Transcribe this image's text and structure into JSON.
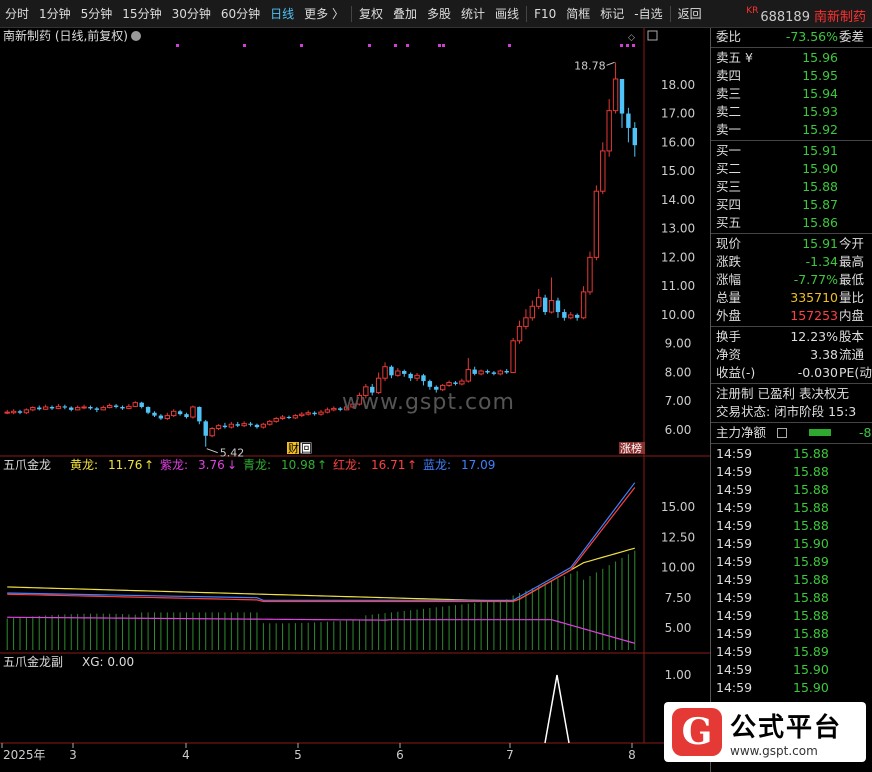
{
  "toolbar": {
    "items": [
      "分时",
      "1分钟",
      "5分钟",
      "15分钟",
      "30分钟",
      "60分钟",
      "日线",
      "更多 〉",
      "复权",
      "叠加",
      "多股",
      "统计",
      "画线",
      "F10",
      "简框",
      "标记",
      "-自选",
      "返回"
    ],
    "active": "日线"
  },
  "stock": {
    "badge": "KR",
    "code": "688189",
    "name": "南新制药"
  },
  "main_chart": {
    "title": "南新制药 (日线,前复权)",
    "title_icon": "chevron-down-icon",
    "y_ticks": [
      "18.00",
      "17.00",
      "16.00",
      "15.00",
      "14.00",
      "13.00",
      "12.00",
      "11.00",
      "10.00",
      "9.00",
      "8.00",
      "7.00",
      "6.00"
    ],
    "high_label": "18.78",
    "low_label": "5.42",
    "tag_cai": "财",
    "tag_hui": "回",
    "tag_zhangbang": "涨榜"
  },
  "indicator1": {
    "name": "五爪金龙",
    "labels": [
      {
        "name": "黄龙:",
        "value": "11.76",
        "arrow": "↑",
        "color": "#f0e040"
      },
      {
        "name": "紫龙:",
        "value": "3.76",
        "arrow": "↓",
        "color": "#e040e0"
      },
      {
        "name": "青龙:",
        "value": "10.98",
        "arrow": "↑",
        "color": "#30b030"
      },
      {
        "name": "红龙:",
        "value": "16.71",
        "arrow": "↑",
        "color": "#ff4040"
      },
      {
        "name": "蓝龙:",
        "value": "17.09",
        "arrow": "",
        "color": "#4080ff"
      }
    ],
    "y_ticks": [
      "15.00",
      "12.50",
      "10.00",
      "7.50",
      "5.00"
    ]
  },
  "indicator2": {
    "name": "五爪金龙副",
    "xg_label": "XG: 0.00",
    "y_ticks": [
      "1.00",
      "0.50"
    ]
  },
  "x_axis": [
    "2025年",
    "3",
    "4",
    "5",
    "6",
    "7",
    "8"
  ],
  "watermark": "www.gspt.com",
  "logo": {
    "glyph": "G",
    "title": "公式平台",
    "url": "www.gspt.com"
  },
  "quote": {
    "weibi": {
      "label": "委比",
      "value": "-73.56%",
      "label2": "委差"
    },
    "asks": [
      {
        "label": "卖五 ¥",
        "price": "15.96"
      },
      {
        "label": "卖四",
        "price": "15.95"
      },
      {
        "label": "卖三",
        "price": "15.94"
      },
      {
        "label": "卖二",
        "price": "15.93"
      },
      {
        "label": "卖一",
        "price": "15.92"
      }
    ],
    "bids": [
      {
        "label": "买一",
        "price": "15.91"
      },
      {
        "label": "买二",
        "price": "15.90"
      },
      {
        "label": "买三",
        "price": "15.88"
      },
      {
        "label": "买四",
        "price": "15.87"
      },
      {
        "label": "买五",
        "price": "15.86"
      }
    ],
    "stats": [
      {
        "label": "现价",
        "value": "15.91",
        "label2": "今开",
        "color": "green"
      },
      {
        "label": "涨跌",
        "value": "-1.34",
        "label2": "最高",
        "color": "green"
      },
      {
        "label": "涨幅",
        "value": "-7.77%",
        "label2": "最低",
        "color": "green"
      },
      {
        "label": "总量",
        "value": "335710",
        "label2": "量比",
        "color": "yellow"
      },
      {
        "label": "外盘",
        "value": "157253",
        "label2": "内盘",
        "color": "red"
      }
    ],
    "stats2": [
      {
        "label": "换手",
        "value": "12.23%",
        "label2": "股本",
        "color": "white"
      },
      {
        "label": "净资",
        "value": "3.38",
        "label2": "流通",
        "color": "white"
      },
      {
        "label": "收益(-)",
        "value": "-0.030",
        "label2": "PE(动",
        "color": "white"
      }
    ],
    "reg": "注册制 已盈利 表决权无",
    "trade_status": "交易状态: 闭市阶段 15:3",
    "main_flow": {
      "label": "主力净额",
      "value": "-8"
    },
    "ticks": [
      {
        "time": "14:59",
        "price": "15.88"
      },
      {
        "time": "14:59",
        "price": "15.88"
      },
      {
        "time": "14:59",
        "price": "15.88"
      },
      {
        "time": "14:59",
        "price": "15.88"
      },
      {
        "time": "14:59",
        "price": "15.88"
      },
      {
        "time": "14:59",
        "price": "15.90"
      },
      {
        "time": "14:59",
        "price": "15.89"
      },
      {
        "time": "14:59",
        "price": "15.88"
      },
      {
        "time": "14:59",
        "price": "15.88"
      },
      {
        "time": "14:59",
        "price": "15.88"
      },
      {
        "time": "14:59",
        "price": "15.88"
      },
      {
        "time": "14:59",
        "price": "15.89"
      },
      {
        "time": "14:59",
        "price": "15.90"
      },
      {
        "time": "14:59",
        "price": "15.90"
      }
    ]
  },
  "chart_data": {
    "type": "candlestick",
    "y_range": [
      5.2,
      19.0
    ],
    "candles": [
      [
        6.6,
        6.62,
        6.7,
        6.55
      ],
      [
        6.6,
        6.65,
        6.72,
        6.55
      ],
      [
        6.65,
        6.6,
        6.7,
        6.55
      ],
      [
        6.6,
        6.7,
        6.75,
        6.55
      ],
      [
        6.7,
        6.78,
        6.82,
        6.65
      ],
      [
        6.78,
        6.72,
        6.85,
        6.68
      ],
      [
        6.72,
        6.8,
        6.88,
        6.7
      ],
      [
        6.8,
        6.75,
        6.85,
        6.7
      ],
      [
        6.75,
        6.82,
        6.9,
        6.72
      ],
      [
        6.82,
        6.78,
        6.88,
        6.72
      ],
      [
        6.78,
        6.7,
        6.82,
        6.65
      ],
      [
        6.7,
        6.78,
        6.85,
        6.68
      ],
      [
        6.78,
        6.8,
        6.88,
        6.72
      ],
      [
        6.8,
        6.75,
        6.85,
        6.7
      ],
      [
        6.75,
        6.7,
        6.8,
        6.62
      ],
      [
        6.7,
        6.78,
        6.85,
        6.68
      ],
      [
        6.78,
        6.85,
        6.92,
        6.75
      ],
      [
        6.85,
        6.8,
        6.9,
        6.75
      ],
      [
        6.8,
        6.75,
        6.85,
        6.7
      ],
      [
        6.75,
        6.82,
        6.9,
        6.72
      ],
      [
        6.82,
        6.95,
        7.0,
        6.8
      ],
      [
        6.95,
        6.8,
        6.98,
        6.75
      ],
      [
        6.8,
        6.6,
        6.82,
        6.55
      ],
      [
        6.6,
        6.5,
        6.65,
        6.45
      ],
      [
        6.5,
        6.4,
        6.55,
        6.35
      ],
      [
        6.4,
        6.5,
        6.6,
        6.35
      ],
      [
        6.5,
        6.65,
        6.72,
        6.45
      ],
      [
        6.65,
        6.55,
        6.7,
        6.5
      ],
      [
        6.55,
        6.45,
        6.6,
        6.4
      ],
      [
        6.45,
        6.8,
        6.85,
        6.4
      ],
      [
        6.8,
        6.3,
        6.82,
        6.2
      ],
      [
        6.3,
        5.8,
        6.35,
        5.42
      ],
      [
        5.8,
        6.05,
        6.1,
        5.75
      ],
      [
        6.05,
        6.15,
        6.2,
        6.0
      ],
      [
        6.15,
        6.1,
        6.25,
        6.05
      ],
      [
        6.1,
        6.2,
        6.28,
        6.05
      ],
      [
        6.2,
        6.15,
        6.28,
        6.1
      ],
      [
        6.15,
        6.22,
        6.3,
        6.1
      ],
      [
        6.22,
        6.18,
        6.28,
        6.12
      ],
      [
        6.18,
        6.1,
        6.22,
        6.05
      ],
      [
        6.1,
        6.2,
        6.25,
        6.05
      ],
      [
        6.2,
        6.3,
        6.35,
        6.15
      ],
      [
        6.3,
        6.4,
        6.45,
        6.25
      ],
      [
        6.4,
        6.45,
        6.52,
        6.35
      ],
      [
        6.45,
        6.42,
        6.5,
        6.38
      ],
      [
        6.42,
        6.5,
        6.55,
        6.38
      ],
      [
        6.5,
        6.55,
        6.62,
        6.45
      ],
      [
        6.55,
        6.6,
        6.68,
        6.5
      ],
      [
        6.6,
        6.55,
        6.65,
        6.5
      ],
      [
        6.55,
        6.62,
        6.7,
        6.5
      ],
      [
        6.62,
        6.7,
        6.78,
        6.58
      ],
      [
        6.7,
        6.75,
        6.82,
        6.65
      ],
      [
        6.75,
        6.7,
        6.8,
        6.65
      ],
      [
        6.7,
        6.8,
        6.88,
        6.68
      ],
      [
        6.8,
        6.9,
        6.98,
        6.75
      ],
      [
        6.9,
        7.2,
        7.3,
        6.85
      ],
      [
        7.2,
        7.5,
        7.6,
        7.1
      ],
      [
        7.5,
        7.3,
        7.6,
        7.2
      ],
      [
        7.3,
        7.8,
        8.0,
        7.25
      ],
      [
        7.8,
        8.2,
        8.35,
        7.7
      ],
      [
        8.2,
        7.9,
        8.25,
        7.8
      ],
      [
        7.9,
        8.05,
        8.15,
        7.85
      ],
      [
        8.05,
        7.95,
        8.1,
        7.85
      ],
      [
        7.95,
        7.8,
        8.0,
        7.7
      ],
      [
        7.8,
        7.9,
        7.98,
        7.7
      ],
      [
        7.9,
        7.7,
        7.95,
        7.55
      ],
      [
        7.7,
        7.5,
        7.75,
        7.4
      ],
      [
        7.5,
        7.4,
        7.55,
        7.3
      ],
      [
        7.4,
        7.55,
        7.6,
        7.35
      ],
      [
        7.55,
        7.65,
        7.72,
        7.5
      ],
      [
        7.65,
        7.6,
        7.7,
        7.55
      ],
      [
        7.6,
        7.7,
        7.78,
        7.55
      ],
      [
        7.7,
        8.1,
        8.5,
        7.65
      ],
      [
        8.1,
        7.95,
        8.2,
        7.9
      ],
      [
        7.95,
        8.05,
        8.1,
        7.9
      ],
      [
        8.05,
        8.0,
        8.1,
        7.95
      ],
      [
        8.0,
        7.95,
        8.05,
        7.9
      ],
      [
        7.95,
        8.05,
        8.1,
        7.9
      ],
      [
        8.05,
        8.0,
        8.12,
        7.95
      ],
      [
        8.0,
        9.1,
        9.2,
        7.98
      ],
      [
        9.1,
        9.6,
        9.8,
        9.0
      ],
      [
        9.6,
        9.9,
        10.2,
        9.5
      ],
      [
        9.9,
        10.3,
        10.5,
        9.8
      ],
      [
        10.3,
        10.6,
        10.9,
        10.2
      ],
      [
        10.6,
        10.1,
        10.7,
        10.0
      ],
      [
        10.1,
        10.5,
        11.3,
        10.05
      ],
      [
        10.5,
        10.1,
        10.6,
        9.9
      ],
      [
        10.1,
        9.9,
        10.2,
        9.8
      ],
      [
        9.9,
        10.0,
        10.1,
        9.85
      ],
      [
        10.0,
        9.9,
        10.05,
        9.8
      ],
      [
        9.9,
        10.8,
        11.0,
        9.85
      ],
      [
        10.8,
        12.0,
        12.2,
        10.7
      ],
      [
        12.0,
        14.3,
        14.5,
        11.9
      ],
      [
        14.3,
        15.7,
        16.0,
        14.2
      ],
      [
        15.7,
        17.1,
        17.5,
        15.5
      ],
      [
        17.1,
        18.2,
        18.78,
        17.0
      ],
      [
        18.2,
        17.0,
        17.3,
        16.5
      ],
      [
        17.0,
        16.5,
        17.2,
        16.0
      ],
      [
        16.5,
        15.9,
        16.7,
        15.5
      ]
    ]
  }
}
